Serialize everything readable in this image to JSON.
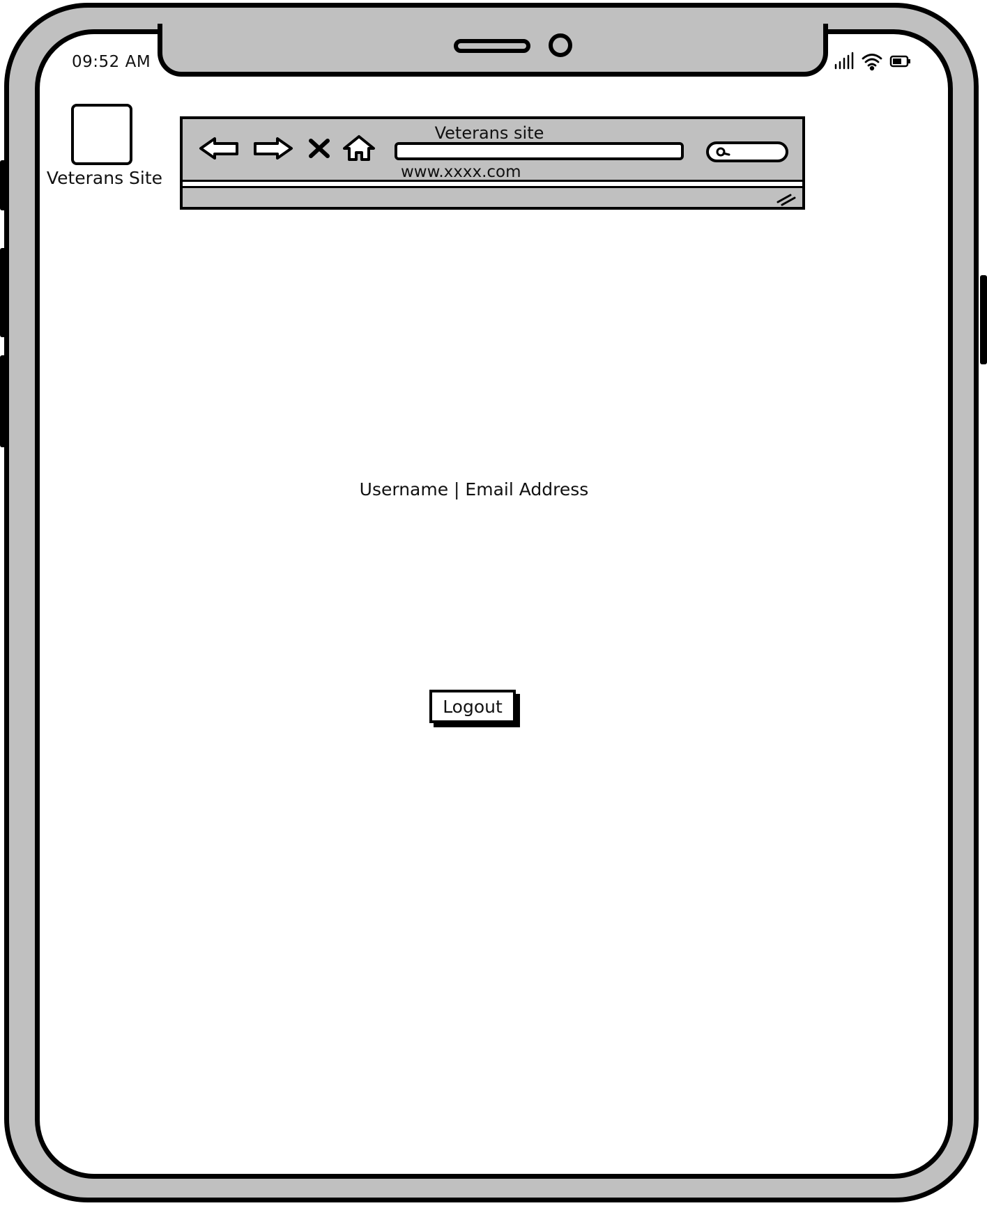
{
  "status_bar": {
    "time": "09:52 AM",
    "icons": [
      "signal-icon",
      "wifi-icon",
      "battery-icon"
    ]
  },
  "app": {
    "icon_label": "Veterans Site"
  },
  "browser": {
    "title": "Veterans site",
    "url": "www.xxxx.com",
    "nav_icons": [
      "back-arrow-icon",
      "forward-arrow-icon",
      "close-icon",
      "home-icon"
    ],
    "search_icon": "search-icon"
  },
  "main": {
    "user_text": "Username | Email Address",
    "logout_label": "Logout"
  },
  "colors": {
    "frame_gray": "#c0c0c0",
    "ink": "#000000",
    "screen": "#ffffff"
  }
}
